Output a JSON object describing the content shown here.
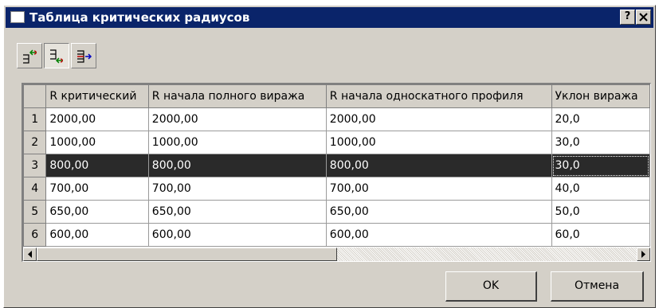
{
  "window": {
    "title": "Таблица критических радиусов",
    "help_label": "?",
    "close_label": "✕"
  },
  "toolbar": {
    "buttons": [
      {
        "icon": "insert-row-before-icon",
        "pressed": false
      },
      {
        "icon": "insert-row-after-icon",
        "pressed": true
      },
      {
        "icon": "delete-row-icon",
        "pressed": false
      }
    ]
  },
  "table": {
    "columns": [
      "R критический",
      "R начала полного виража",
      "R начала односкатного профиля",
      "Уклон виража"
    ],
    "rows": [
      {
        "num": "1",
        "cells": [
          "2000,00",
          "2000,00",
          "2000,00",
          "20,0"
        ]
      },
      {
        "num": "2",
        "cells": [
          "1000,00",
          "1000,00",
          "1000,00",
          "30,0"
        ]
      },
      {
        "num": "3",
        "cells": [
          "800,00",
          "800,00",
          "800,00",
          "30,0"
        ]
      },
      {
        "num": "4",
        "cells": [
          "700,00",
          "700,00",
          "700,00",
          "40,0"
        ]
      },
      {
        "num": "5",
        "cells": [
          "650,00",
          "650,00",
          "650,00",
          "50,0"
        ]
      },
      {
        "num": "6",
        "cells": [
          "600,00",
          "600,00",
          "600,00",
          "60,0"
        ]
      }
    ],
    "selected_row": 3
  },
  "buttons": {
    "ok": "OK",
    "cancel": "Отмена"
  },
  "colors": {
    "titlebar": "#0a246a",
    "face": "#d4d0c8",
    "selection": "#2a2a2a"
  }
}
